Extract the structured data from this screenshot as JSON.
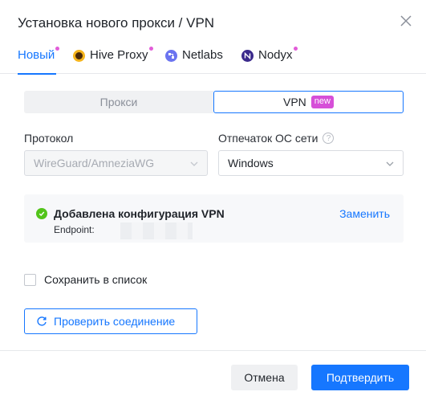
{
  "dialog": {
    "title": "Установка нового прокси / VPN"
  },
  "tabs": [
    {
      "label": "Новый",
      "icon": "",
      "dot": true,
      "active": true
    },
    {
      "label": "Hive Proxy",
      "icon": "hive-logo",
      "dot": true,
      "active": false
    },
    {
      "label": "Netlabs",
      "icon": "netlabs-logo",
      "dot": false,
      "active": false
    },
    {
      "label": "Nodyx",
      "icon": "nodyx-logo",
      "dot": true,
      "active": false
    }
  ],
  "segment": {
    "proxy_label": "Прокси",
    "vpn_label": "VPN",
    "vpn_badge": "new",
    "selected": "VPN"
  },
  "protocol": {
    "label": "Протокол",
    "value": "WireGuard/AmneziaWG",
    "disabled": true
  },
  "os_fingerprint": {
    "label": "Отпечаток ОС сети",
    "help_icon": "question-circle-icon",
    "value": "Windows"
  },
  "config": {
    "title": "Добавлена конфигурация VPN",
    "replace_label": "Заменить",
    "endpoint_label": "Endpoint:",
    "status_icon": "check-circle-icon"
  },
  "save_to_list": {
    "label": "Сохранить в список",
    "checked": false
  },
  "test_button": {
    "label": "Проверить соединение",
    "icon": "refresh-icon"
  },
  "footer": {
    "cancel_label": "Отмена",
    "confirm_label": "Подтвердить"
  },
  "colors": {
    "accent": "#1677ff",
    "badge": "#d64fd8",
    "success": "#52c41a"
  }
}
